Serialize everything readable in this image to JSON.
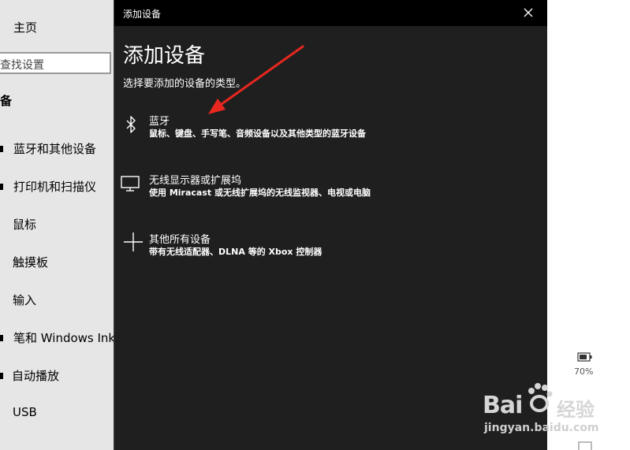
{
  "sidebar": {
    "home_label": "主页",
    "search_placeholder": "查找设置",
    "section_title": "备",
    "items": [
      {
        "label": "蓝牙和其他设备"
      },
      {
        "label": "打印机和扫描仪"
      },
      {
        "label": "鼠标"
      },
      {
        "label": "触摸板"
      },
      {
        "label": "输入"
      },
      {
        "label": "笔和 Windows Ink"
      },
      {
        "label": "自动播放"
      },
      {
        "label": "USB"
      }
    ]
  },
  "dialog": {
    "window_title": "添加设备",
    "heading": "添加设备",
    "subheading": "选择要添加的设备的类型。",
    "options": [
      {
        "icon": "bluetooth-icon",
        "label": "蓝牙",
        "description": "鼠标、键盘、手写笔、音频设备以及其他类型的蓝牙设备"
      },
      {
        "icon": "monitor-icon",
        "label": "无线显示器或扩展坞",
        "description": "使用 Miracast 或无线扩展坞的无线监视器、电视或电脑"
      },
      {
        "icon": "plus-icon",
        "label": "其他所有设备",
        "description": "带有无线适配器、DLNA 等的 Xbox 控制器"
      }
    ]
  },
  "system": {
    "battery_percent": "70%"
  },
  "watermark": {
    "logo_text": "Bai",
    "logo_suffix": "经验",
    "url": "jingyan.baidu.com"
  },
  "colors": {
    "dialog_bg": "#1f1f1f",
    "titlebar_bg": "#000000",
    "sidebar_bg": "#e6e6e6",
    "annotation_arrow": "#e8271f"
  }
}
